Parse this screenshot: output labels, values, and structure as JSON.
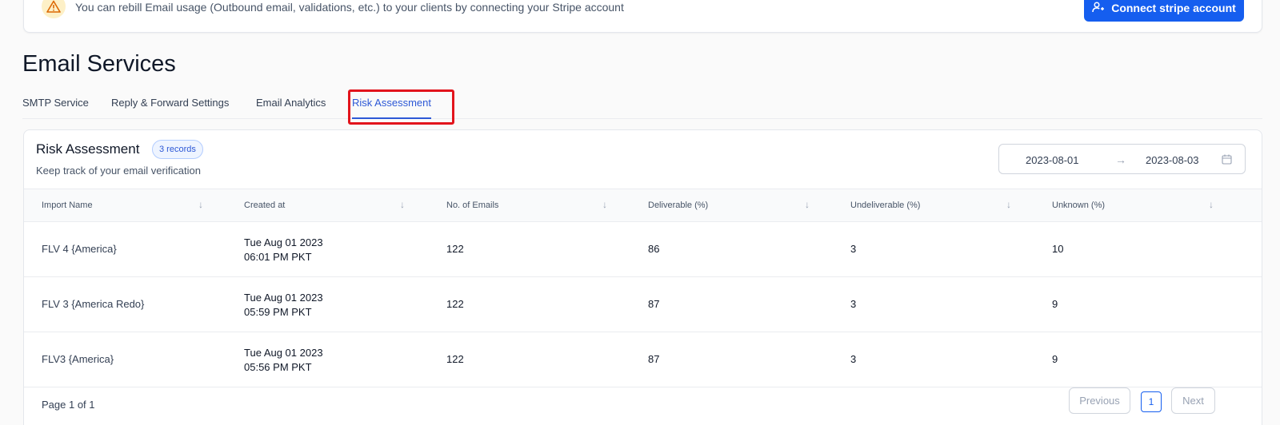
{
  "banner": {
    "text": "You can rebill Email usage (Outbound email, validations, etc.) to your clients by connecting your Stripe account",
    "button_label": "Connect stripe account",
    "icon": "warning-icon"
  },
  "page": {
    "title": "Email Services"
  },
  "tabs": [
    {
      "label": "SMTP Service"
    },
    {
      "label": "Reply & Forward Settings"
    },
    {
      "label": "Email Analytics"
    },
    {
      "label": "Risk Assessment",
      "active": true
    }
  ],
  "card": {
    "title": "Risk Assessment",
    "badge": "3 records",
    "subtitle": "Keep track of your email verification",
    "date_start": "2023-08-01",
    "date_end": "2023-08-03"
  },
  "table": {
    "columns": [
      "Import Name",
      "Created at",
      "No. of Emails",
      "Deliverable (%)",
      "Undeliverable (%)",
      "Unknown (%)"
    ],
    "rows": [
      {
        "name": "FLV 4 {America}",
        "date": "Tue Aug 01 2023",
        "time": "06:01 PM PKT",
        "emails": "122",
        "deliverable": "86",
        "undeliverable": "3",
        "unknown": "10"
      },
      {
        "name": "FLV 3 {America Redo}",
        "date": "Tue Aug 01 2023",
        "time": "05:59 PM PKT",
        "emails": "122",
        "deliverable": "87",
        "undeliverable": "3",
        "unknown": "9"
      },
      {
        "name": "FLV3 {America}",
        "date": "Tue Aug 01 2023",
        "time": "05:56 PM PKT",
        "emails": "122",
        "deliverable": "87",
        "undeliverable": "3",
        "unknown": "9"
      }
    ]
  },
  "pagination": {
    "info": "Page 1 of 1",
    "previous": "Previous",
    "current": "1",
    "next": "Next"
  },
  "colors": {
    "accent": "#155eef",
    "active_tab": "#2d58d6",
    "highlight": "#e2141c"
  }
}
